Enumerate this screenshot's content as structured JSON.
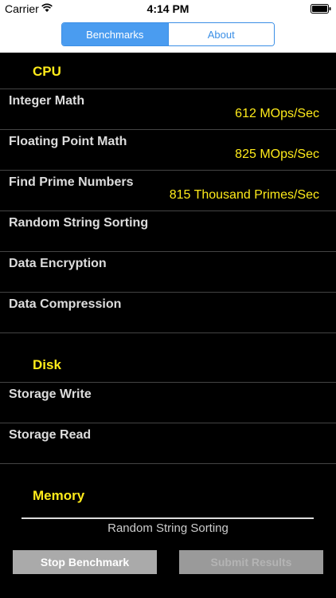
{
  "status_bar": {
    "carrier": "Carrier",
    "time": "4:14 PM"
  },
  "tabs": [
    {
      "label": "Benchmarks",
      "active": true
    },
    {
      "label": "About",
      "active": false
    }
  ],
  "sections": {
    "cpu": {
      "title": "CPU",
      "rows": [
        {
          "label": "Integer Math",
          "value": "612 MOps/Sec"
        },
        {
          "label": "Floating Point Math",
          "value": "825 MOps/Sec"
        },
        {
          "label": "Find Prime Numbers",
          "value": "815 Thousand Primes/Sec"
        },
        {
          "label": "Random String Sorting",
          "value": ""
        },
        {
          "label": "Data Encryption",
          "value": ""
        },
        {
          "label": "Data Compression",
          "value": ""
        }
      ]
    },
    "disk": {
      "title": "Disk",
      "rows": [
        {
          "label": "Storage Write",
          "value": ""
        },
        {
          "label": "Storage Read",
          "value": ""
        }
      ]
    },
    "memory": {
      "title": "Memory"
    }
  },
  "footer": {
    "current_task": "Random String Sorting",
    "stop_button": "Stop Benchmark",
    "submit_button": "Submit Results"
  },
  "colors": {
    "accent": "#3b8fe6",
    "section_title": "#ffeb1a",
    "value_text": "#ffeb1a"
  }
}
